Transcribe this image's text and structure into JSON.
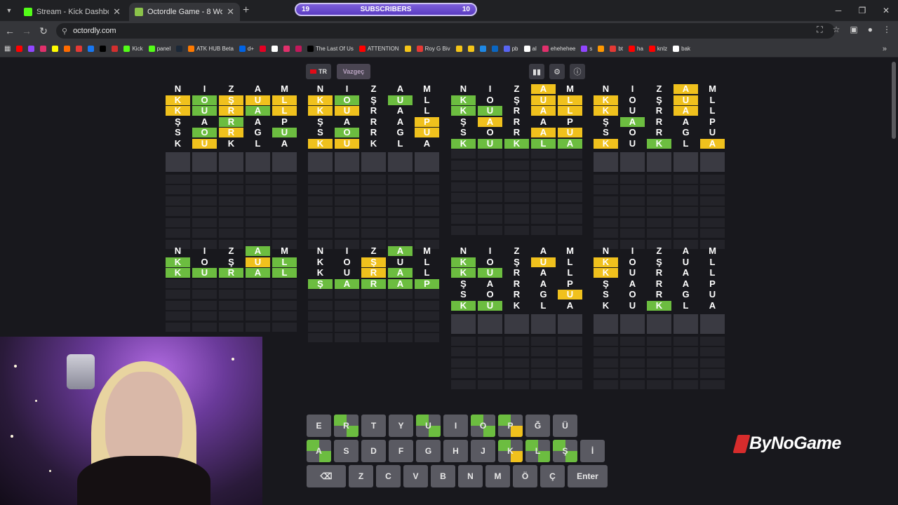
{
  "browser": {
    "tabs": [
      {
        "title": "Stream - Kick Dashboard",
        "favicon_color": "#53fc18",
        "active": false
      },
      {
        "title": "Octordle Game - 8 Words Wor",
        "favicon_color": "#8bc34a",
        "active": true
      }
    ],
    "new_tab_icon": "+",
    "subscribers": {
      "left": "19",
      "label": "SUBSCRIBERS",
      "right": "10"
    },
    "url": "octordly.com",
    "bookmarks": [
      {
        "label": "",
        "color": "#ff0000"
      },
      {
        "label": "",
        "color": "#9146ff"
      },
      {
        "label": "",
        "color": "#e1306c"
      },
      {
        "label": "",
        "color": "#fffc00"
      },
      {
        "label": "",
        "color": "#ff6b00"
      },
      {
        "label": "",
        "color": "#e53935"
      },
      {
        "label": "",
        "color": "#1877f2"
      },
      {
        "label": "",
        "color": "#000000"
      },
      {
        "label": "",
        "color": "#d32f2f"
      },
      {
        "label": "Kick",
        "color": "#53fc18"
      },
      {
        "label": "panel",
        "color": "#53fc18"
      },
      {
        "label": "",
        "color": "#1b2838"
      },
      {
        "label": "ATK HUB Beta",
        "color": "#ff7a00"
      },
      {
        "label": "d+",
        "color": "#0063e5"
      },
      {
        "label": "",
        "color": "#e60023"
      },
      {
        "label": "",
        "color": "#ffffff"
      },
      {
        "label": "",
        "color": "#e1306c"
      },
      {
        "label": "",
        "color": "#c2185b"
      },
      {
        "label": "The Last Of Us",
        "color": "#000000"
      },
      {
        "label": "ATTENTION",
        "color": "#ff0000"
      },
      {
        "label": "",
        "color": "#f5c518"
      },
      {
        "label": "Roy G Biv",
        "color": "#e53935"
      },
      {
        "label": "",
        "color": "#f5c518"
      },
      {
        "label": "",
        "color": "#f5c518"
      },
      {
        "label": "",
        "color": "#1e88e5"
      },
      {
        "label": "",
        "color": "#0a66c2"
      },
      {
        "label": "pb",
        "color": "#5865f2"
      },
      {
        "label": "al",
        "color": "#ffffff"
      },
      {
        "label": "ehehehee",
        "color": "#e1306c"
      },
      {
        "label": "s",
        "color": "#9146ff"
      },
      {
        "label": "",
        "color": "#ff9800"
      },
      {
        "label": "bt",
        "color": "#e53935"
      },
      {
        "label": "ha",
        "color": "#ff0000"
      },
      {
        "label": "knlz",
        "color": "#ff0000"
      },
      {
        "label": "bak",
        "color": "#ffffff"
      }
    ]
  },
  "game": {
    "lang_label": "TR",
    "give_up_label": "Vazgeç",
    "tools": [
      "stats-icon",
      "settings-icon",
      "info-icon"
    ],
    "boards": [
      {
        "rows": [
          [
            "N.",
            "I.",
            "Z.",
            "A.",
            "M."
          ],
          [
            "Ky",
            "Og",
            "Şy",
            "Uy",
            "Ly"
          ],
          [
            "Ky",
            "Ug",
            "Ry",
            "Ag",
            "Ly"
          ],
          [
            "Ş.",
            "A.",
            "Rg",
            "A.",
            "P."
          ],
          [
            "S.",
            "Og",
            "Ry",
            "G.",
            "Ug"
          ],
          [
            "K.",
            "Uy",
            "K.",
            "L.",
            "A."
          ]
        ],
        "current": true,
        "empty_rows": 7
      },
      {
        "rows": [
          [
            "N.",
            "I.",
            "Z.",
            "A.",
            "M."
          ],
          [
            "Ky",
            "Og",
            "Ş.",
            "Ug",
            "L."
          ],
          [
            "Ky",
            "Uy",
            "R.",
            "A.",
            "L."
          ],
          [
            "Ş.",
            "A.",
            "R.",
            "A.",
            "Py"
          ],
          [
            "S.",
            "Og",
            "R.",
            "G.",
            "Uy"
          ],
          [
            "Ky",
            "Uy",
            "K.",
            "L.",
            "A."
          ]
        ],
        "current": true,
        "empty_rows": 7
      },
      {
        "rows": [
          [
            "N.",
            "I.",
            "Z.",
            "Ay",
            "M."
          ],
          [
            "Kg",
            "O.",
            "Ş.",
            "Uy",
            "Ly"
          ],
          [
            "Kg",
            "Ug",
            "R.",
            "Ay",
            "Ly"
          ],
          [
            "Ş.",
            "Ay",
            "R.",
            "A.",
            "P."
          ],
          [
            "S.",
            "O.",
            "R.",
            "Ay",
            "Uy"
          ],
          [
            "Kg",
            "Ug",
            "Kg",
            "Lg",
            "Ag"
          ]
        ],
        "current": false,
        "empty_rows": 8
      },
      {
        "rows": [
          [
            "N.",
            "I.",
            "Z.",
            "Ay",
            "M."
          ],
          [
            "Ky",
            "O.",
            "Ş.",
            "Uy",
            "L."
          ],
          [
            "Ky",
            "U.",
            "R.",
            "Ay",
            "L."
          ],
          [
            "Ş.",
            "Ag",
            "R.",
            "A.",
            "P."
          ],
          [
            "S.",
            "O.",
            "R.",
            "G.",
            "U."
          ],
          [
            "Ky",
            "U.",
            "Kg",
            "L.",
            "Ay"
          ]
        ],
        "current": true,
        "empty_rows": 7
      },
      {
        "rows": [
          [
            "N.",
            "I.",
            "Z.",
            "Ag",
            "M."
          ],
          [
            "Kg",
            "O.",
            "Ş.",
            "Uy",
            "Lg"
          ],
          [
            "Kg",
            "Ug",
            "Rg",
            "Ag",
            "Lg"
          ]
        ],
        "current": false,
        "empty_rows": 10
      },
      {
        "rows": [
          [
            "N.",
            "I.",
            "Z.",
            "Ag",
            "M."
          ],
          [
            "K.",
            "O.",
            "Şy",
            "U.",
            "L."
          ],
          [
            "K.",
            "U.",
            "Ry",
            "Ag",
            "L."
          ],
          [
            "Şg",
            "Ag",
            "Rg",
            "Ag",
            "Pg"
          ]
        ],
        "current": false,
        "empty_rows": 9
      },
      {
        "rows": [
          [
            "N.",
            "I.",
            "Z.",
            "A.",
            "M."
          ],
          [
            "Kg",
            "O.",
            "Ş.",
            "Uy",
            "L."
          ],
          [
            "Kg",
            "Ug",
            "R.",
            "A.",
            "L."
          ],
          [
            "Ş.",
            "A.",
            "R.",
            "A.",
            "P."
          ],
          [
            "S.",
            "O.",
            "R.",
            "G.",
            "Uy"
          ],
          [
            "Kg",
            "Ug",
            "K.",
            "L.",
            "A."
          ]
        ],
        "current": true,
        "empty_rows": 7
      },
      {
        "rows": [
          [
            "N.",
            "I.",
            "Z.",
            "A.",
            "M."
          ],
          [
            "Ky",
            "O.",
            "Ş.",
            "U.",
            "L."
          ],
          [
            "Ky",
            "U.",
            "R.",
            "A.",
            "L."
          ],
          [
            "Ş.",
            "A.",
            "R.",
            "A.",
            "P."
          ],
          [
            "S.",
            "O.",
            "R.",
            "G.",
            "U."
          ],
          [
            "K.",
            "U.",
            "Kg",
            "L.",
            "A."
          ]
        ],
        "current": true,
        "empty_rows": 7
      }
    ],
    "keyboard": {
      "row1": [
        {
          "k": "E",
          "s": ""
        },
        {
          "k": "R",
          "s": "split"
        },
        {
          "k": "T",
          "s": ""
        },
        {
          "k": "Y",
          "s": ""
        },
        {
          "k": "U",
          "s": "split"
        },
        {
          "k": "I",
          "s": ""
        },
        {
          "k": "O",
          "s": "split"
        },
        {
          "k": "P",
          "s": "split half-y"
        },
        {
          "k": "Ğ",
          "s": ""
        },
        {
          "k": "Ü",
          "s": ""
        }
      ],
      "row2": [
        {
          "k": "A",
          "s": "split"
        },
        {
          "k": "S",
          "s": ""
        },
        {
          "k": "D",
          "s": ""
        },
        {
          "k": "F",
          "s": ""
        },
        {
          "k": "G",
          "s": ""
        },
        {
          "k": "H",
          "s": ""
        },
        {
          "k": "J",
          "s": ""
        },
        {
          "k": "K",
          "s": "split half-y"
        },
        {
          "k": "L",
          "s": "split"
        },
        {
          "k": "Ş",
          "s": "split"
        },
        {
          "k": "İ",
          "s": ""
        }
      ],
      "row3": [
        {
          "k": "⌫",
          "s": "wide"
        },
        {
          "k": "Z",
          "s": ""
        },
        {
          "k": "C",
          "s": ""
        },
        {
          "k": "V",
          "s": ""
        },
        {
          "k": "B",
          "s": ""
        },
        {
          "k": "N",
          "s": ""
        },
        {
          "k": "M",
          "s": ""
        },
        {
          "k": "Ö",
          "s": ""
        },
        {
          "k": "Ç",
          "s": ""
        },
        {
          "k": "Enter",
          "s": "enter"
        }
      ]
    }
  },
  "overlay": {
    "brand": "ByNoGame"
  }
}
